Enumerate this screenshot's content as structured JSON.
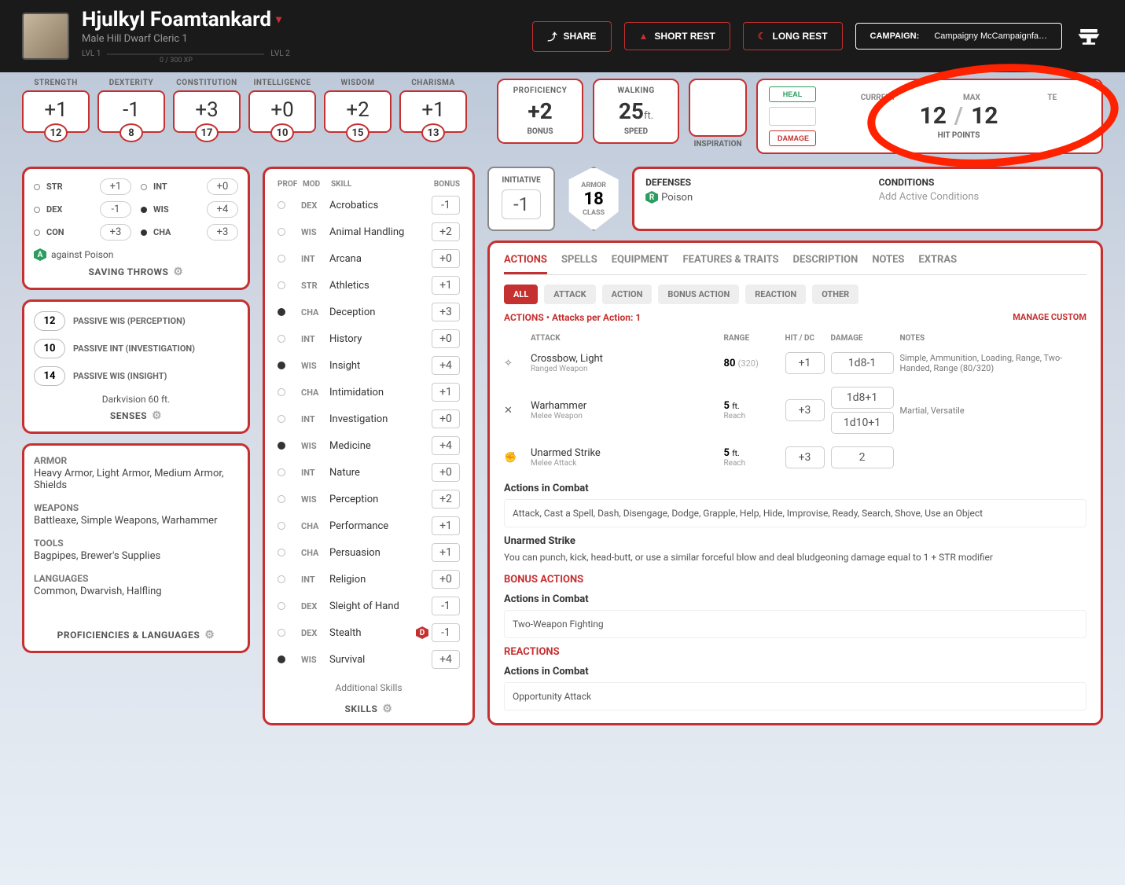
{
  "header": {
    "name": "Hjulkyl Foamtankard",
    "subtitle": "Male  Hill Dwarf  Cleric 1",
    "lvl_from": "LVL 1",
    "lvl_to": "LVL 2",
    "xp": "0 / 300 XP",
    "share": "SHARE",
    "short_rest": "SHORT REST",
    "long_rest": "LONG REST",
    "campaign_label": "CAMPAIGN:",
    "campaign_name": "Campaigny McCampaignfa…"
  },
  "abilities": [
    {
      "name": "STRENGTH",
      "mod": "+1",
      "score": "12"
    },
    {
      "name": "DEXTERITY",
      "mod": "-1",
      "score": "8"
    },
    {
      "name": "CONSTITUTION",
      "mod": "+3",
      "score": "17"
    },
    {
      "name": "INTELLIGENCE",
      "mod": "+0",
      "score": "10"
    },
    {
      "name": "WISDOM",
      "mod": "+2",
      "score": "15"
    },
    {
      "name": "CHARISMA",
      "mod": "+1",
      "score": "13"
    }
  ],
  "proficiency": {
    "label": "PROFICIENCY",
    "value": "+2",
    "sub": "BONUS"
  },
  "speed": {
    "label": "WALKING",
    "value": "25",
    "unit": "ft.",
    "sub": "SPEED"
  },
  "inspiration": "INSPIRATION",
  "hp": {
    "heal": "HEAL",
    "damage": "DAMAGE",
    "current_lbl": "CURRENT",
    "max_lbl": "MAX",
    "temp_lbl": "TE",
    "current": "12",
    "max": "12",
    "footer": "HIT POINTS"
  },
  "saves": {
    "rows": [
      {
        "abbr": "STR",
        "val": "+1",
        "prof": false
      },
      {
        "abbr": "INT",
        "val": "+0",
        "prof": false
      },
      {
        "abbr": "DEX",
        "val": "-1",
        "prof": false
      },
      {
        "abbr": "WIS",
        "val": "+4",
        "prof": true
      },
      {
        "abbr": "CON",
        "val": "+3",
        "prof": false
      },
      {
        "abbr": "CHA",
        "val": "+3",
        "prof": true
      }
    ],
    "note": "against Poison",
    "title": "SAVING THROWS"
  },
  "senses": {
    "rows": [
      {
        "val": "12",
        "lbl": "PASSIVE WIS (PERCEPTION)"
      },
      {
        "val": "10",
        "lbl": "PASSIVE INT (INVESTIGATION)"
      },
      {
        "val": "14",
        "lbl": "PASSIVE WIS (INSIGHT)"
      }
    ],
    "extra": "Darkvision 60 ft.",
    "title": "SENSES"
  },
  "profs": {
    "armor_h": "ARMOR",
    "armor": "Heavy Armor, Light Armor, Medium Armor, Shields",
    "weapons_h": "WEAPONS",
    "weapons": "Battleaxe, Simple Weapons, Warhammer",
    "tools_h": "TOOLS",
    "tools": "Bagpipes, Brewer's Supplies",
    "lang_h": "LANGUAGES",
    "lang": "Common, Dwarvish, Halfling",
    "title": "PROFICIENCIES & LANGUAGES"
  },
  "skills": {
    "head": {
      "prof": "PROF",
      "mod": "MOD",
      "skill": "SKILL",
      "bonus": "BONUS"
    },
    "rows": [
      {
        "prof": false,
        "mod": "DEX",
        "name": "Acrobatics",
        "bonus": "-1"
      },
      {
        "prof": false,
        "mod": "WIS",
        "name": "Animal Handling",
        "bonus": "+2"
      },
      {
        "prof": false,
        "mod": "INT",
        "name": "Arcana",
        "bonus": "+0"
      },
      {
        "prof": false,
        "mod": "STR",
        "name": "Athletics",
        "bonus": "+1"
      },
      {
        "prof": true,
        "mod": "CHA",
        "name": "Deception",
        "bonus": "+3"
      },
      {
        "prof": false,
        "mod": "INT",
        "name": "History",
        "bonus": "+0"
      },
      {
        "prof": true,
        "mod": "WIS",
        "name": "Insight",
        "bonus": "+4"
      },
      {
        "prof": false,
        "mod": "CHA",
        "name": "Intimidation",
        "bonus": "+1"
      },
      {
        "prof": false,
        "mod": "INT",
        "name": "Investigation",
        "bonus": "+0"
      },
      {
        "prof": true,
        "mod": "WIS",
        "name": "Medicine",
        "bonus": "+4"
      },
      {
        "prof": false,
        "mod": "INT",
        "name": "Nature",
        "bonus": "+0"
      },
      {
        "prof": false,
        "mod": "WIS",
        "name": "Perception",
        "bonus": "+2"
      },
      {
        "prof": false,
        "mod": "CHA",
        "name": "Performance",
        "bonus": "+1"
      },
      {
        "prof": false,
        "mod": "CHA",
        "name": "Persuasion",
        "bonus": "+1"
      },
      {
        "prof": false,
        "mod": "INT",
        "name": "Religion",
        "bonus": "+0"
      },
      {
        "prof": false,
        "mod": "DEX",
        "name": "Sleight of Hand",
        "bonus": "-1"
      },
      {
        "prof": false,
        "mod": "DEX",
        "name": "Stealth",
        "bonus": "-1",
        "disadv": true
      },
      {
        "prof": true,
        "mod": "WIS",
        "name": "Survival",
        "bonus": "+4"
      }
    ],
    "additional": "Additional Skills",
    "title": "SKILLS"
  },
  "initiative": {
    "label": "INITIATIVE",
    "value": "-1"
  },
  "armor": {
    "label": "ARMOR",
    "value": "18",
    "sub": "CLASS"
  },
  "def_cond": {
    "def_h": "DEFENSES",
    "def_val": "Poison",
    "cond_h": "CONDITIONS",
    "cond_val": "Add Active Conditions"
  },
  "tabs": [
    "ACTIONS",
    "SPELLS",
    "EQUIPMENT",
    "FEATURES & TRAITS",
    "DESCRIPTION",
    "NOTES",
    "EXTRAS"
  ],
  "filters": [
    "ALL",
    "ATTACK",
    "ACTION",
    "BONUS ACTION",
    "REACTION",
    "OTHER"
  ],
  "actions_line": "ACTIONS • Attacks per Action: 1",
  "manage": "MANAGE CUSTOM",
  "atk_head": {
    "attack": "ATTACK",
    "range": "RANGE",
    "hit": "HIT / DC",
    "damage": "DAMAGE",
    "notes": "NOTES"
  },
  "attacks": [
    {
      "icon": "✧",
      "name": "Crossbow, Light",
      "sub": "Ranged Weapon",
      "range": "80",
      "range_sub": "(320)",
      "hit": "+1",
      "dmg": [
        "1d8-1"
      ],
      "notes": "Simple, Ammunition, Loading, Range, Two-Handed, Range (80/320)"
    },
    {
      "icon": "✕",
      "name": "Warhammer",
      "sub": "Melee Weapon",
      "range": "5",
      "range_unit": "ft.",
      "range_sub2": "Reach",
      "hit": "+3",
      "dmg": [
        "1d8+1",
        "1d10+1"
      ],
      "notes": "Martial, Versatile"
    },
    {
      "icon": "✊",
      "name": "Unarmed Strike",
      "sub": "Melee Attack",
      "range": "5",
      "range_unit": "ft.",
      "range_sub2": "Reach",
      "hit": "+3",
      "dmg": [
        "2"
      ],
      "notes": ""
    }
  ],
  "combat": {
    "h1": "Actions in Combat",
    "list": "Attack, Cast a Spell, Dash, Disengage, Dodge, Grapple, Help, Hide, Improvise, Ready, Search, Shove, Use an Object",
    "unarmed_h": "Unarmed Strike",
    "unarmed_p": "You can punch, kick, head-butt, or use a similar forceful blow and deal bludgeoning damage equal to 1 + STR modifier",
    "bonus_h": "BONUS ACTIONS",
    "bonus_list": "Two-Weapon Fighting",
    "react_h": "REACTIONS",
    "react_list": "Opportunity Attack"
  }
}
